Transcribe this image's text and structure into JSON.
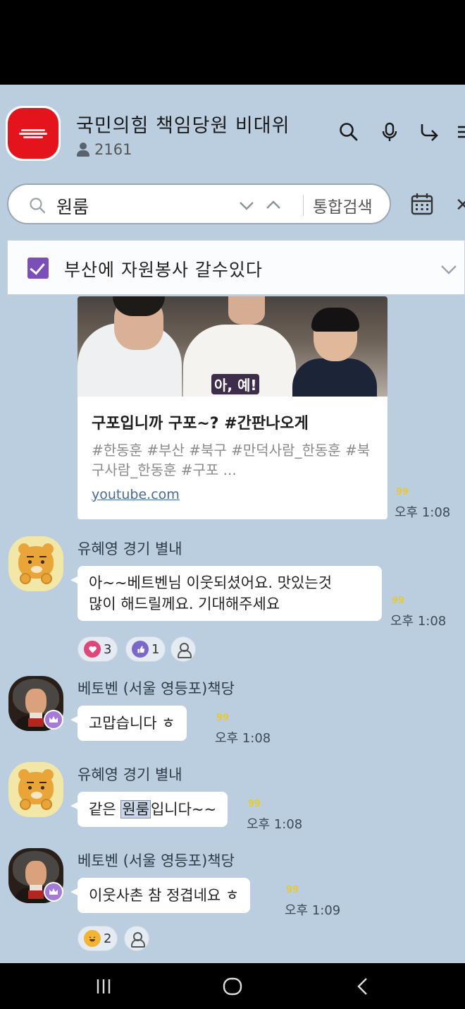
{
  "header": {
    "room_title": "국민의힘 책임당원 비대위",
    "member_count": "2161"
  },
  "search": {
    "query": "원룸",
    "integrated_search_label": "통합검색"
  },
  "notice": {
    "text": "부산에 자원봉사 갈수있다"
  },
  "link_card": {
    "thumbnail_caption": "아, 예!",
    "title": "구포입니까 구포~? #간판나오게",
    "description": "#한동훈 #부산 #북구 #만덕사람_한동훈 #북구사람_한동훈 #구포 ...",
    "domain": "youtube.com",
    "time": "오후 1:08"
  },
  "messages": [
    {
      "sender": "유혜영 경기 별내",
      "lines": [
        "아~~베트벤님 이웃되셨어요. 맛있는것",
        "많이 해드릴께요. 기대해주세요"
      ],
      "time": "오후 1:08",
      "reactions": [
        {
          "icon": "heart-reaction-icon",
          "count": "3"
        },
        {
          "icon": "thumbs-up-reaction-icon",
          "count": "1"
        }
      ]
    },
    {
      "sender": "베토벤 (서울 영등포)책당",
      "text": "고맙습니다 ㅎ",
      "time": "오후 1:08"
    },
    {
      "sender": "유혜영 경기 별내",
      "text_before": "같은 ",
      "text_highlight": "원룸",
      "text_after": "입니다~~",
      "time": "오후 1:08"
    },
    {
      "sender": "베토벤 (서울 영등포)책당",
      "text": "이웃사촌 참 정겹네요 ㅎ",
      "time": "오후 1:09",
      "reactions": [
        {
          "icon": "laugh-reaction-icon",
          "count": "2"
        }
      ]
    }
  ],
  "read_marker": "99",
  "colors": {
    "chat_background": "#bacee0",
    "room_avatar": "#e3141b",
    "notice_check": "#7a4fb8",
    "highlight": "#c9d6ea"
  }
}
